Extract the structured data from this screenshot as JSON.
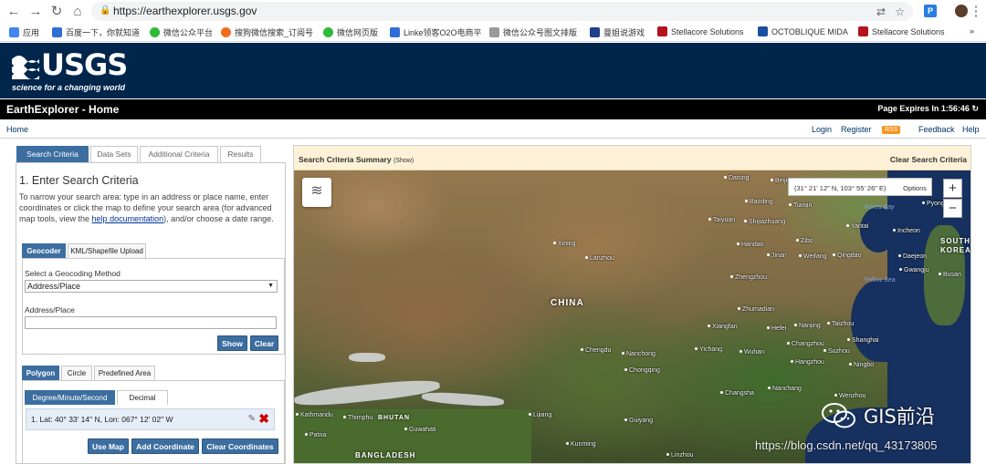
{
  "browser": {
    "url": "https://earthexplorer.usgs.gov",
    "bookmarks": [
      "应用",
      "百度一下，你就知道",
      "微信公众平台",
      "搜狗微信搜索_订阅号",
      "微信网页版",
      "Linke领客O2O电商平",
      "微信公众号图文排版",
      "曼姐说游戏",
      "Stellacore Solutions",
      "OCTOBLIQUE MIDA",
      "Stellacore Solutions"
    ],
    "bookmark_colors": [
      "#4285f4",
      "#2f6fd6",
      "#2dbb38",
      "#f26b1d",
      "#2dbb38",
      "#2f6fd6",
      "#999999",
      "#1f3f8c",
      "#b5121b",
      "#1a4fa3",
      "#b5121b"
    ]
  },
  "header": {
    "logo_text": "USGS",
    "logo_tagline": "science for a changing world",
    "app_title": "EarthExplorer - Home",
    "page_expires": "Page Expires In 1:56:46"
  },
  "nav": {
    "home": "Home",
    "login": "Login",
    "register": "Register",
    "rss": "RSS",
    "feedback": "Feedback",
    "help": "Help"
  },
  "tabs": [
    "Search Criteria",
    "Data Sets",
    "Additional Criteria",
    "Results"
  ],
  "criteria": {
    "heading": "1. Enter Search Criteria",
    "intro_before": "To narrow your search area: type in an address or place name, enter coordinates or click the map to define your search area (for advanced map tools, view the ",
    "intro_link": "help documentation",
    "intro_after": "), and/or choose a date range.",
    "geo_tabs": [
      "Geocoder",
      "KML/Shapefile Upload"
    ],
    "method_label": "Select a Geocoding Method",
    "method_value": "Address/Place",
    "address_label": "Address/Place",
    "address_value": "",
    "show_btn": "Show",
    "clear_btn": "Clear",
    "area_tabs": [
      "Polygon",
      "Circle",
      "Predefined Area"
    ],
    "coord_tabs": [
      "Degree/Minute/Second",
      "Decimal"
    ],
    "coordinate_entry": "1.  Lat: 40° 33' 14\" N, Lon: 067° 12' 02\" W",
    "use_map_btn": "Use Map",
    "add_coord_btn": "Add Coordinate",
    "clear_coords_btn": "Clear Coordinates"
  },
  "map": {
    "summary_title": "Search Criteria Summary",
    "summary_show": "(Show)",
    "clear_criteria": "Clear Search Criteria",
    "cursor_coords": "(31° 21' 12\" N, 103° 55' 26\" E)",
    "options": "Options",
    "zoom_in": "+",
    "zoom_out": "−",
    "country_labels": [
      "CHINA",
      "BHUTAN",
      "BANGLADESH",
      "SOUTH",
      "KOREA"
    ],
    "sea_labels": [
      "Yellow Sea",
      "Korea Bay"
    ],
    "cities": [
      "Datong",
      "Beijing",
      "Baoding",
      "Tianjin",
      "Taiyuan",
      "Shijiazhuang",
      "Yantai",
      "Incheon",
      "Pyongyang",
      "Xining",
      "Handan",
      "Zibo",
      "Jinan",
      "Weifang",
      "Qingdao",
      "Daejeon",
      "Gwangju",
      "Busan",
      "Lanzhou",
      "Zhengzhou",
      "Zhumadian",
      "Xiangfan",
      "Hefei",
      "Nanjing",
      "Taizhou",
      "Changzhou",
      "Shanghai",
      "Suzhou",
      "Chengdu",
      "Nanchong",
      "Yichang",
      "Wuhan",
      "Hangzhou",
      "Ningbo",
      "Chongqing",
      "Changsha",
      "Nanchang",
      "Wenzhou",
      "Kathmandu",
      "Thimphu",
      "Lijiang",
      "Guiyang",
      "Patna",
      "Guwahati",
      "Kunming",
      "Linzhou"
    ],
    "watermark_text": "GIS前沿",
    "watermark_url": "https://blog.csdn.net/qq_43173805"
  }
}
